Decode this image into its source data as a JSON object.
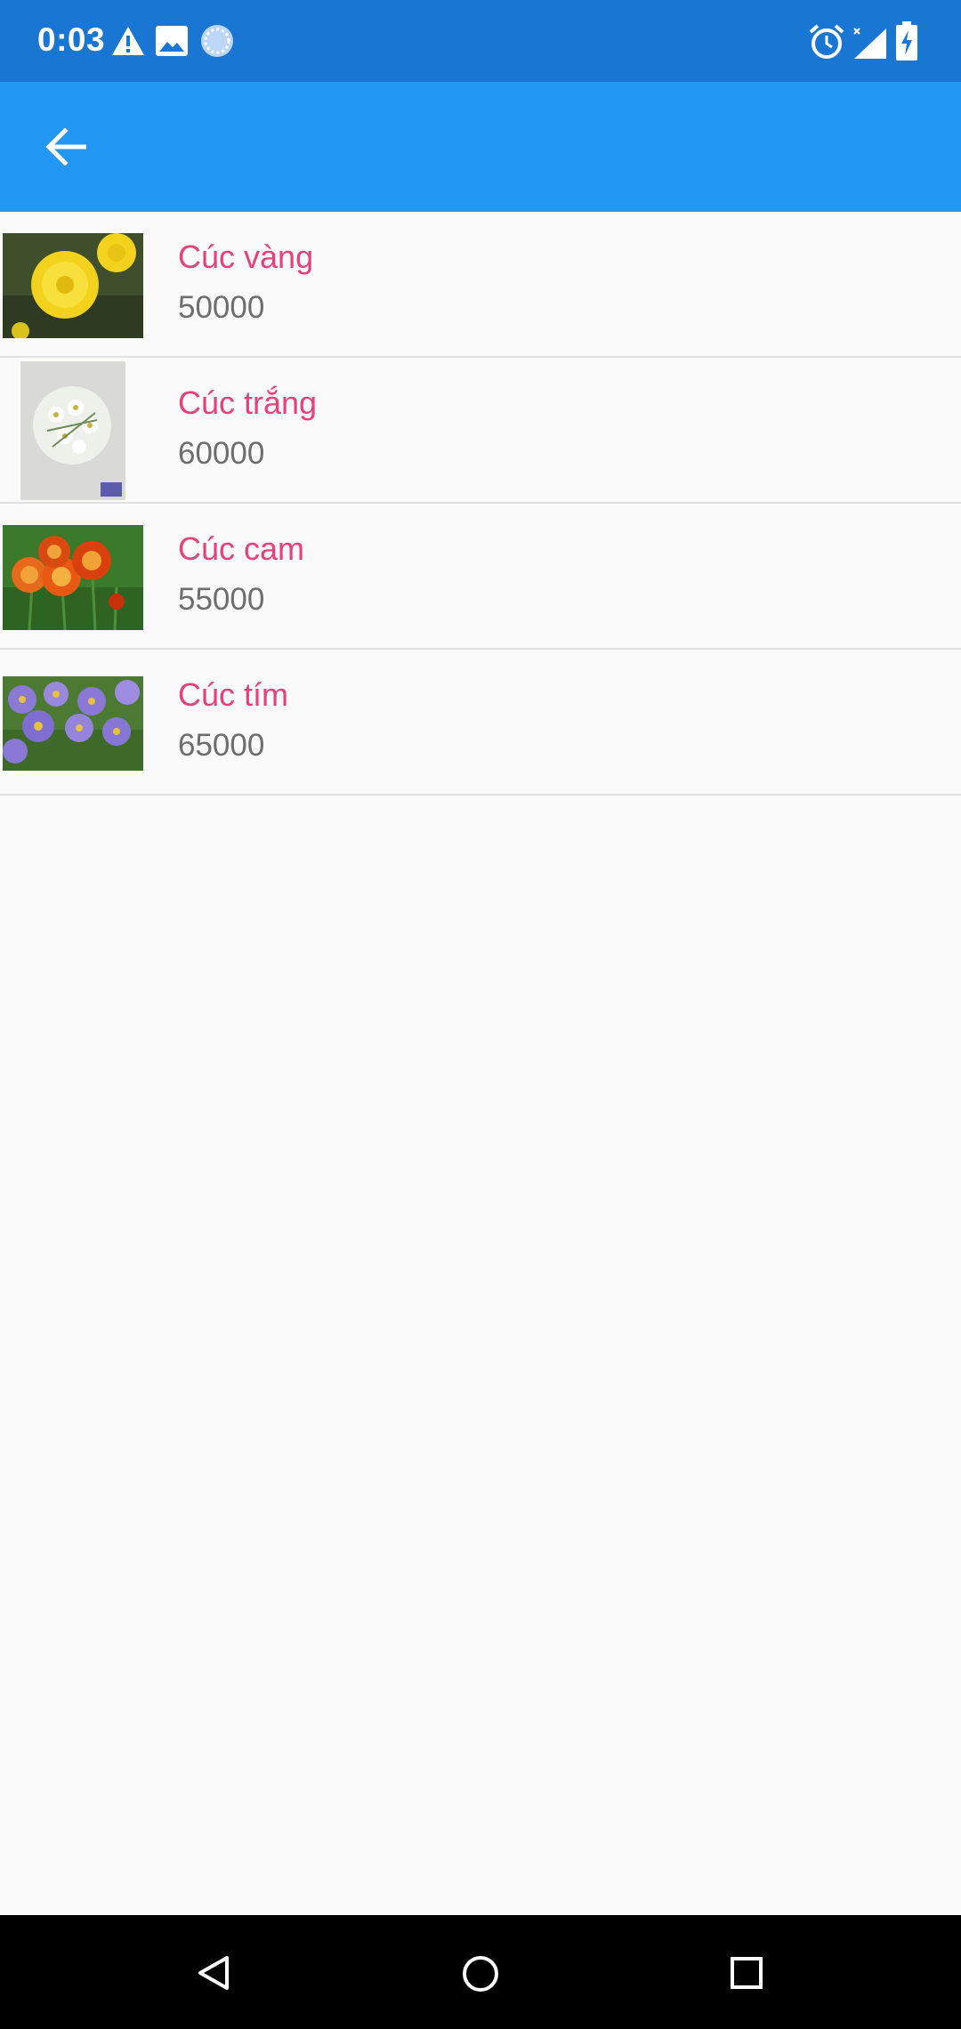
{
  "status_bar": {
    "time": "0:03",
    "left_icons": [
      "warning-icon",
      "image-icon",
      "sync-icon"
    ],
    "right_icons": [
      "alarm-icon",
      "signal-icon",
      "battery-charging-icon"
    ]
  },
  "app_bar": {
    "back_icon": "arrow-back-icon"
  },
  "products": [
    {
      "name": "Cúc vàng",
      "price": "50000",
      "image": "yellow-chrysanthemum-image"
    },
    {
      "name": "Cúc trắng",
      "price": "60000",
      "image": "white-chrysanthemum-image"
    },
    {
      "name": "Cúc cam",
      "price": "55000",
      "image": "orange-chrysanthemum-image"
    },
    {
      "name": "Cúc tím",
      "price": "65000",
      "image": "purple-chrysanthemum-image"
    }
  ],
  "colors": {
    "status_bar": "#1976d2",
    "app_bar": "#2196f3",
    "name_text": "#e8407a",
    "price_text": "#6d6d6d",
    "background": "#fafafa"
  },
  "nav_bar": {
    "icons": [
      "back-triangle-icon",
      "home-circle-icon",
      "recents-square-icon"
    ]
  }
}
